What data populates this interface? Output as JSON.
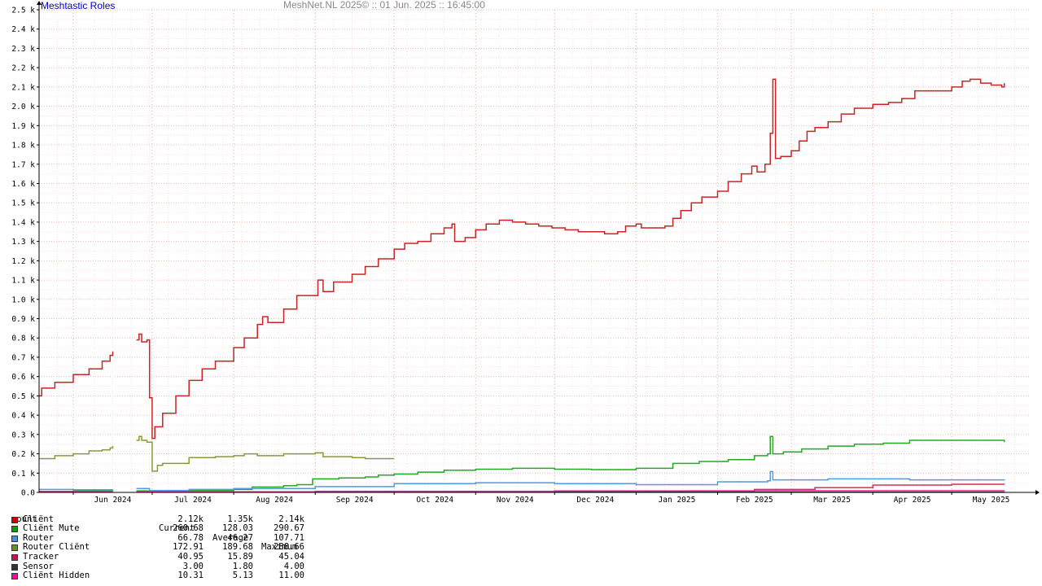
{
  "header": {
    "title": "Meshtastic Roles",
    "timestamp": "MeshNet.NL 2025© ::  01 Jun. 2025 :: 16:45:00"
  },
  "legend": {
    "headers": [
      "count",
      "Current",
      "Average",
      "Maximum"
    ],
    "rows": [
      {
        "label": "Cliënt",
        "color": "#cc0000",
        "current": "2.12k",
        "average": "1.35k",
        "maximum": "2.14k"
      },
      {
        "label": "Cliënt Mute",
        "color": "#00a000",
        "current": "260.68",
        "average": "128.03",
        "maximum": "290.67"
      },
      {
        "label": "Router",
        "color": "#4a90d9",
        "current": "66.78",
        "average": "46.27",
        "maximum": "107.71"
      },
      {
        "label": "Router Cliënt",
        "color": "#6b8e23",
        "current": "172.91",
        "average": "189.68",
        "maximum": "288.66"
      },
      {
        "label": "Tracker",
        "color": "#cc1050",
        "current": "40.95",
        "average": "15.89",
        "maximum": "45.04"
      },
      {
        "label": "Sensor",
        "color": "#333333",
        "current": "3.00",
        "average": "1.80",
        "maximum": "4.00"
      },
      {
        "label": "Cliënt Hidden",
        "color": "#ee1090",
        "current": "10.31",
        "average": "5.13",
        "maximum": "11.00"
      }
    ]
  },
  "chart_data": {
    "type": "line",
    "title": "Meshtastic Roles",
    "ylim": [
      0,
      2500
    ],
    "y_ticks": [
      "0.0",
      "0.1 k",
      "0.2 k",
      "0.3 k",
      "0.4 k",
      "0.5 k",
      "0.6 k",
      "0.7 k",
      "0.8 k",
      "0.9 k",
      "1.0 k",
      "1.1 k",
      "1.2 k",
      "1.3 k",
      "1.4 k",
      "1.5 k",
      "1.6 k",
      "1.7 k",
      "1.8 k",
      "1.9 k",
      "2.0 k",
      "2.1 k",
      "2.2 k",
      "2.3 k",
      "2.4 k",
      "2.5 k"
    ],
    "xlim": [
      "2024-05-19",
      "2025-05-31"
    ],
    "x_ticks": [
      {
        "label": "Jun 2024",
        "date": "2024-06-01"
      },
      {
        "label": "Jul 2024",
        "date": "2024-07-01"
      },
      {
        "label": "Aug 2024",
        "date": "2024-08-01"
      },
      {
        "label": "Sep 2024",
        "date": "2024-09-01"
      },
      {
        "label": "Oct 2024",
        "date": "2024-10-01"
      },
      {
        "label": "Nov 2024",
        "date": "2024-11-01"
      },
      {
        "label": "Dec 2024",
        "date": "2024-12-01"
      },
      {
        "label": "Jan 2025",
        "date": "2025-01-01"
      },
      {
        "label": "Feb 2025",
        "date": "2025-02-01"
      },
      {
        "label": "Mar 2025",
        "date": "2025-03-01"
      },
      {
        "label": "Apr 2025",
        "date": "2025-04-01"
      },
      {
        "label": "May 2025",
        "date": "2025-05-01"
      }
    ],
    "grid": true,
    "series": [
      {
        "name": "Cliënt",
        "color": "#cc2222",
        "segments": [
          [
            [
              "2024-05-19",
              500
            ],
            [
              "2024-05-20",
              540
            ],
            [
              "2024-05-25",
              570
            ],
            [
              "2024-06-01",
              610
            ],
            [
              "2024-06-07",
              640
            ],
            [
              "2024-06-12",
              680
            ],
            [
              "2024-06-15",
              710
            ],
            [
              "2024-06-16",
              730
            ]
          ],
          [
            [
              "2024-06-25",
              790
            ],
            [
              "2024-06-26",
              820
            ],
            [
              "2024-06-27",
              780
            ],
            [
              "2024-06-29",
              790
            ],
            [
              "2024-06-30",
              490
            ],
            [
              "2024-07-01",
              280
            ],
            [
              "2024-07-02",
              340
            ],
            [
              "2024-07-05",
              410
            ],
            [
              "2024-07-10",
              500
            ],
            [
              "2024-07-15",
              580
            ],
            [
              "2024-07-20",
              640
            ],
            [
              "2024-07-25",
              680
            ],
            [
              "2024-08-01",
              750
            ],
            [
              "2024-08-05",
              800
            ],
            [
              "2024-08-10",
              870
            ],
            [
              "2024-08-12",
              910
            ],
            [
              "2024-08-14",
              880
            ],
            [
              "2024-08-20",
              950
            ],
            [
              "2024-08-25",
              1020
            ],
            [
              "2024-09-01",
              1020
            ],
            [
              "2024-09-02",
              1100
            ],
            [
              "2024-09-04",
              1040
            ],
            [
              "2024-09-08",
              1090
            ],
            [
              "2024-09-15",
              1130
            ],
            [
              "2024-09-20",
              1170
            ],
            [
              "2024-09-25",
              1210
            ],
            [
              "2024-10-01",
              1260
            ],
            [
              "2024-10-05",
              1290
            ],
            [
              "2024-10-10",
              1300
            ],
            [
              "2024-10-15",
              1340
            ],
            [
              "2024-10-20",
              1370
            ],
            [
              "2024-10-23",
              1390
            ],
            [
              "2024-10-24",
              1300
            ],
            [
              "2024-10-28",
              1320
            ],
            [
              "2024-11-01",
              1360
            ],
            [
              "2024-11-05",
              1390
            ],
            [
              "2024-11-10",
              1410
            ],
            [
              "2024-11-15",
              1400
            ],
            [
              "2024-11-20",
              1390
            ],
            [
              "2024-11-25",
              1380
            ],
            [
              "2024-11-30",
              1370
            ],
            [
              "2024-12-05",
              1360
            ],
            [
              "2024-12-10",
              1350
            ],
            [
              "2024-12-15",
              1350
            ],
            [
              "2024-12-20",
              1340
            ],
            [
              "2024-12-25",
              1350
            ],
            [
              "2024-12-28",
              1380
            ],
            [
              "2025-01-01",
              1390
            ],
            [
              "2025-01-03",
              1370
            ],
            [
              "2025-01-08",
              1370
            ],
            [
              "2025-01-12",
              1380
            ],
            [
              "2025-01-15",
              1420
            ],
            [
              "2025-01-18",
              1460
            ],
            [
              "2025-01-22",
              1500
            ],
            [
              "2025-01-26",
              1530
            ],
            [
              "2025-02-01",
              1560
            ],
            [
              "2025-02-05",
              1610
            ],
            [
              "2025-02-10",
              1650
            ],
            [
              "2025-02-14",
              1690
            ],
            [
              "2025-02-16",
              1660
            ],
            [
              "2025-02-19",
              1700
            ],
            [
              "2025-02-21",
              1860
            ],
            [
              "2025-02-22",
              2140
            ],
            [
              "2025-02-23",
              1730
            ],
            [
              "2025-02-25",
              1740
            ],
            [
              "2025-03-01",
              1770
            ],
            [
              "2025-03-04",
              1820
            ],
            [
              "2025-03-07",
              1870
            ],
            [
              "2025-03-10",
              1890
            ],
            [
              "2025-03-15",
              1920
            ],
            [
              "2025-03-20",
              1960
            ],
            [
              "2025-03-25",
              1990
            ],
            [
              "2025-04-01",
              2010
            ],
            [
              "2025-04-07",
              2020
            ],
            [
              "2025-04-12",
              2040
            ],
            [
              "2025-04-17",
              2080
            ],
            [
              "2025-04-25",
              2080
            ],
            [
              "2025-05-01",
              2100
            ],
            [
              "2025-05-05",
              2130
            ],
            [
              "2025-05-08",
              2140
            ],
            [
              "2025-05-12",
              2120
            ],
            [
              "2025-05-16",
              2110
            ],
            [
              "2025-05-20",
              2100
            ],
            [
              "2025-05-21",
              2120
            ]
          ]
        ]
      },
      {
        "name": "Cliënt Mute",
        "color": "#22aa22",
        "segments": [
          [
            [
              "2024-05-19",
              5
            ],
            [
              "2024-06-01",
              8
            ],
            [
              "2024-06-16",
              10
            ]
          ],
          [
            [
              "2024-06-25",
              8
            ],
            [
              "2024-07-15",
              10
            ],
            [
              "2024-08-01",
              15
            ],
            [
              "2024-08-08",
              28
            ],
            [
              "2024-08-20",
              35
            ],
            [
              "2024-08-25",
              40
            ],
            [
              "2024-08-31",
              70
            ],
            [
              "2024-09-10",
              75
            ],
            [
              "2024-09-20",
              80
            ],
            [
              "2024-09-25",
              90
            ],
            [
              "2024-10-01",
              95
            ],
            [
              "2024-10-10",
              105
            ],
            [
              "2024-10-20",
              115
            ],
            [
              "2024-11-01",
              120
            ],
            [
              "2024-11-15",
              125
            ],
            [
              "2024-12-01",
              120
            ],
            [
              "2024-12-15",
              118
            ],
            [
              "2025-01-01",
              125
            ],
            [
              "2025-01-15",
              150
            ],
            [
              "2025-01-25",
              160
            ],
            [
              "2025-02-05",
              170
            ],
            [
              "2025-02-15",
              190
            ],
            [
              "2025-02-20",
              200
            ],
            [
              "2025-02-21",
              290
            ],
            [
              "2025-02-22",
              200
            ],
            [
              "2025-02-26",
              210
            ],
            [
              "2025-03-05",
              225
            ],
            [
              "2025-03-15",
              240
            ],
            [
              "2025-03-25",
              250
            ],
            [
              "2025-04-05",
              255
            ],
            [
              "2025-04-15",
              270
            ],
            [
              "2025-04-25",
              270
            ],
            [
              "2025-05-05",
              270
            ],
            [
              "2025-05-15",
              270
            ],
            [
              "2025-05-21",
              260
            ]
          ]
        ]
      },
      {
        "name": "Router",
        "color": "#5599dd",
        "segments": [
          [
            [
              "2024-05-19",
              15
            ],
            [
              "2024-06-01",
              14
            ],
            [
              "2024-06-16",
              15
            ]
          ],
          [
            [
              "2024-06-25",
              20
            ],
            [
              "2024-06-28",
              20
            ],
            [
              "2024-06-30",
              10
            ],
            [
              "2024-07-15",
              15
            ],
            [
              "2024-08-01",
              20
            ],
            [
              "2024-09-01",
              30
            ],
            [
              "2024-10-01",
              45
            ],
            [
              "2024-11-01",
              50
            ],
            [
              "2024-12-01",
              45
            ],
            [
              "2025-01-01",
              40
            ],
            [
              "2025-02-01",
              55
            ],
            [
              "2025-02-20",
              60
            ],
            [
              "2025-02-21",
              108
            ],
            [
              "2025-02-22",
              65
            ],
            [
              "2025-03-15",
              70
            ],
            [
              "2025-04-15",
              65
            ],
            [
              "2025-05-01",
              65
            ],
            [
              "2025-05-21",
              67
            ]
          ]
        ]
      },
      {
        "name": "Router Cliënt",
        "color": "#88993a",
        "segments": [
          [
            [
              "2024-05-19",
              175
            ],
            [
              "2024-05-25",
              190
            ],
            [
              "2024-06-01",
              200
            ],
            [
              "2024-06-07",
              215
            ],
            [
              "2024-06-12",
              220
            ],
            [
              "2024-06-15",
              230
            ],
            [
              "2024-06-16",
              240
            ]
          ],
          [
            [
              "2024-06-25",
              270
            ],
            [
              "2024-06-26",
              290
            ],
            [
              "2024-06-27",
              270
            ],
            [
              "2024-06-29",
              260
            ],
            [
              "2024-07-01",
              110
            ],
            [
              "2024-07-03",
              140
            ],
            [
              "2024-07-05",
              150
            ],
            [
              "2024-07-10",
              150
            ],
            [
              "2024-07-15",
              180
            ],
            [
              "2024-07-25",
              185
            ],
            [
              "2024-08-01",
              190
            ],
            [
              "2024-08-05",
              200
            ],
            [
              "2024-08-10",
              190
            ],
            [
              "2024-08-15",
              190
            ],
            [
              "2024-08-20",
              200
            ],
            [
              "2024-09-01",
              205
            ],
            [
              "2024-09-04",
              185
            ],
            [
              "2024-09-15",
              180
            ],
            [
              "2024-09-20",
              175
            ],
            [
              "2024-09-25",
              175
            ],
            [
              "2024-10-01",
              175
            ]
          ]
        ]
      },
      {
        "name": "Tracker",
        "color": "#cc3355",
        "segments": [
          [
            [
              "2024-05-19",
              2
            ],
            [
              "2024-06-16",
              2
            ]
          ],
          [
            [
              "2024-06-25",
              2
            ],
            [
              "2024-09-01",
              3
            ],
            [
              "2024-12-01",
              5
            ],
            [
              "2025-01-20",
              8
            ],
            [
              "2025-02-15",
              15
            ],
            [
              "2025-03-10",
              25
            ],
            [
              "2025-04-01",
              38
            ],
            [
              "2025-05-01",
              42
            ],
            [
              "2025-05-21",
              41
            ]
          ]
        ]
      },
      {
        "name": "Sensor",
        "color": "#333333",
        "segments": [
          [
            [
              "2024-05-19",
              1
            ],
            [
              "2024-06-16",
              1
            ]
          ],
          [
            [
              "2024-06-25",
              1
            ],
            [
              "2025-05-21",
              3
            ]
          ]
        ]
      },
      {
        "name": "Cliënt Hidden",
        "color": "#ee2299",
        "segments": [
          [
            [
              "2024-05-19",
              3
            ],
            [
              "2024-06-16",
              3
            ]
          ],
          [
            [
              "2024-06-25",
              3
            ],
            [
              "2024-09-01",
              6
            ],
            [
              "2024-12-01",
              8
            ],
            [
              "2025-02-15",
              9
            ],
            [
              "2025-05-21",
              10
            ]
          ]
        ]
      }
    ]
  }
}
